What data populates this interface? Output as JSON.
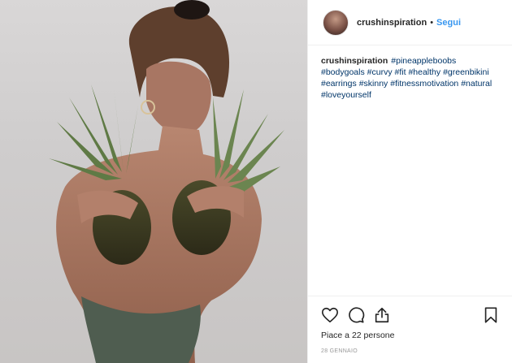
{
  "post": {
    "author": {
      "username": "crushinspiration",
      "separator": "•",
      "follow_label": "Segui"
    },
    "caption": {
      "username": "crushinspiration",
      "hashtag_lines": [
        [
          "#pineappleboobs"
        ],
        [
          "#bodygoals",
          "#curvy",
          "#fit",
          "#healthy",
          "#greenbikini"
        ],
        [
          "#earrings",
          "#skinny",
          "#fitnessmotivation",
          "#natural"
        ],
        [
          "#loveyourself"
        ]
      ]
    },
    "likes_text": "Piace a 22 persone",
    "date_text": "28 GENNAIO",
    "icons": {
      "like": "heart-icon",
      "comment": "comment-icon",
      "share": "share-icon",
      "save": "bookmark-icon"
    },
    "colors": {
      "link_blue": "#3897f0",
      "hashtag": "#003569",
      "text": "#262626",
      "divider": "#efefef"
    }
  }
}
